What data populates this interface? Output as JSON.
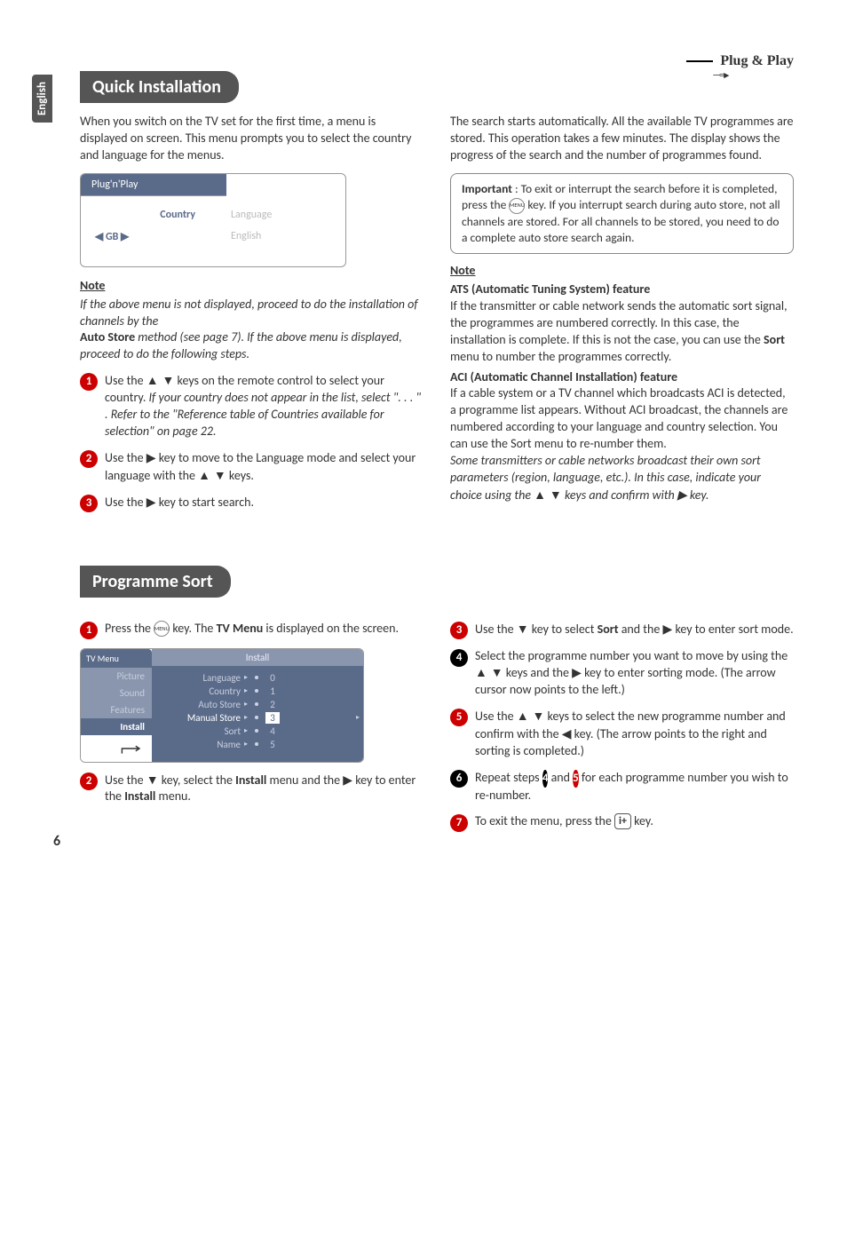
{
  "sideTab": "English",
  "plugPlay": "Plug & Play",
  "pageNum": "6",
  "section1": {
    "title": "Quick Installation",
    "intro": "When you switch on the TV set for the first time, a menu is displayed on screen. This menu prompts you to select the country and language for the menus.",
    "menu": {
      "header": "Plug'n'Play",
      "countryLbl": "Country",
      "languageLbl": "Language",
      "countryVal": "GB",
      "languageVal": "English"
    },
    "noteHead": "Note",
    "noteBody1": "If the above menu is not displayed, proceed to do the installation of channels by the ",
    "noteBody2a": "Auto Store",
    "noteBody2b": " method (see page 7). If the above menu is displayed, proceed to do the following steps.",
    "step1a": "Use the ",
    "step1b": " keys on the remote control to select your country. ",
    "step1c": "If your country does not appear in the list, select  \". . . \" . Refer to the \"Reference table of Countries available for selection\" on page 22.",
    "step2a": "Use the  ",
    "step2b": "  key to move to the Language mode and select your language with the ",
    "step2c": " keys.",
    "step3a": "Use the  ",
    "step3b": " key to start search.",
    "rightIntro": "The search starts automatically. All the available TV programmes are stored. This operation takes a few minutes. The display shows the progress of the search and the number of programmes found.",
    "importantLabel": "Important",
    "importantText1": " : To exit or interrupt the search before it is completed, press the ",
    "importantText2": " key. If you interrupt search during auto store, not all channels are stored. For all channels to be stored, you need to do a complete auto store search again.",
    "atsHead": "ATS (Automatic Tuning System) feature",
    "atsBody": "If the transmitter or cable network sends the automatic sort signal, the programmes are numbered correctly. In this case, the installation is complete. If this is not the case, you can use the ",
    "atsBody2": " menu to number the programmes correctly.",
    "sortWord": "Sort",
    "aciHead": "ACI (Automatic Channel Installation) feature",
    "aciBody": "If a cable system or a TV channel which broadcasts ACI is detected, a programme list appears. Without ACI broadcast, the channels are numbered according to your language and country selection. You can use the Sort menu to re-number them.",
    "aciItalic1": "Some transmitters or cable networks broadcast their own sort parameters (region, language, etc.). In this case, indicate your choice using the ",
    "aciItalic2": " keys and confirm with ",
    "aciItalic3": " key.",
    "menuKey": "MENU"
  },
  "section2": {
    "title": "Programme Sort",
    "step1a": "Press the ",
    "step1b": " key. The ",
    "step1c": "TV Menu",
    "step1d": " is displayed on the screen.",
    "tvMenu": {
      "tab": "TV Menu",
      "side": [
        "Picture",
        "Sound",
        "Features",
        "Install"
      ],
      "mainHead": "Install",
      "rows": [
        {
          "label": "Language",
          "num": "0"
        },
        {
          "label": "Country",
          "num": "1"
        },
        {
          "label": "Auto Store",
          "num": "2"
        },
        {
          "label": "Manual Store",
          "num": "3",
          "active": true
        },
        {
          "label": "Sort",
          "num": "4"
        },
        {
          "label": "Name",
          "num": "5"
        }
      ]
    },
    "step2a": "Use the ",
    "step2b": " key, select the ",
    "step2c": "Install",
    "step2d": " menu and the ",
    "step2e": " key to enter the ",
    "step2f": " menu.",
    "step3a": "Use the ",
    "step3b": " key to select ",
    "step3c": "Sort",
    "step3d": " and the ",
    "step3e": " key to enter sort mode.",
    "step4a": "Select the programme number you want to move by using the ",
    "step4b": " keys and the ",
    "step4c": " key to enter sorting mode. (The arrow cursor now points to the left.)",
    "step5a": "Use the ",
    "step5b": "  keys to select the new programme number and confirm with the ",
    "step5c": " key. (The arrow points to the right and sorting is completed.)",
    "step6a": "Repeat steps  ",
    "step6b": " and  ",
    "step6c": " for each programme number you wish to re-number.",
    "step6n1": "4",
    "step6n2": "5",
    "step7a": "To exit the menu, press the  ",
    "step7b": "  key.",
    "infoKey": "i+"
  }
}
